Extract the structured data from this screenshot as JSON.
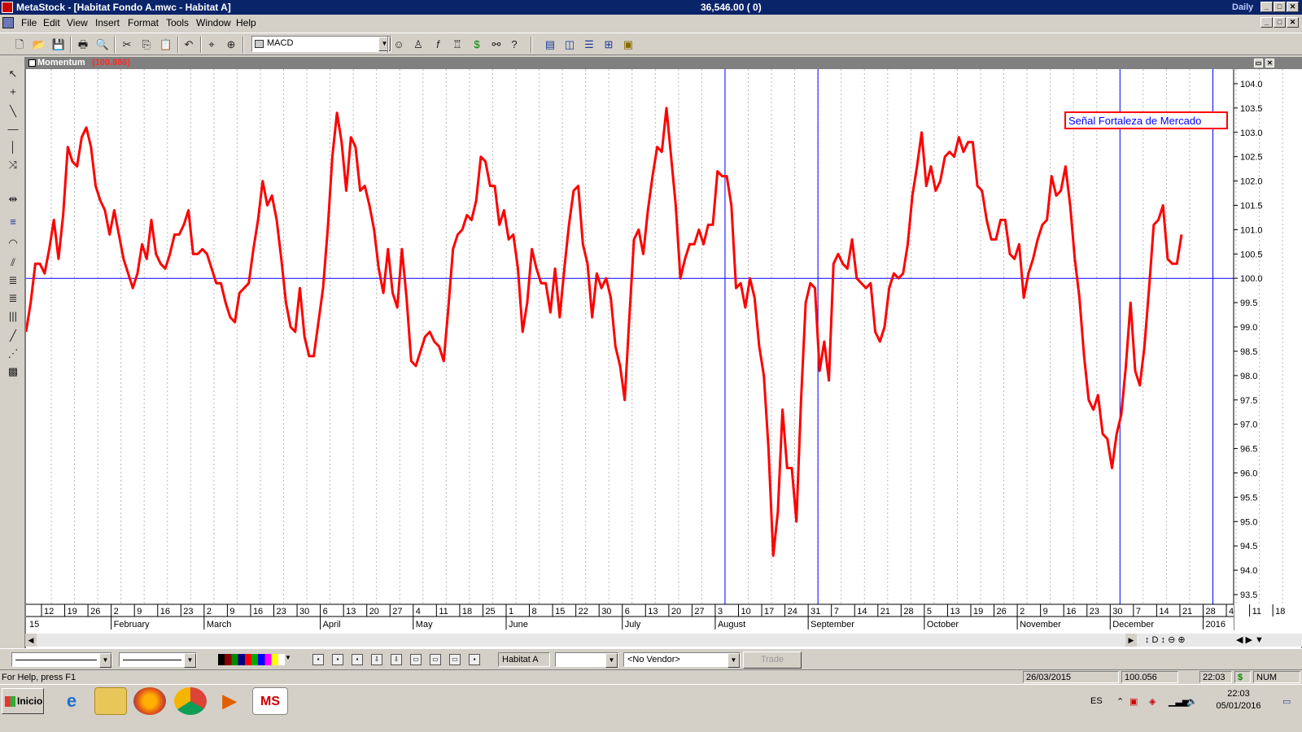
{
  "window": {
    "title": "MetaStock - [Habitat Fondo A.mwc - Habitat A]",
    "center_text": "36,546.00 ( 0)",
    "periodicity": "Daily"
  },
  "menu": {
    "items": [
      "File",
      "Edit",
      "View",
      "Insert",
      "Format",
      "Tools",
      "Window",
      "Help"
    ]
  },
  "toolbar": {
    "indicator_combo": "MACD"
  },
  "chart_window": {
    "indicator_name": "Momentum",
    "indicator_value": "(100.886)"
  },
  "chart_data": {
    "type": "line",
    "title": "",
    "xlabel": "",
    "ylabel": "",
    "ylim": [
      93.3,
      104.3
    ],
    "yticks": [
      "104.0",
      "103.5",
      "103.0",
      "102.5",
      "102.0",
      "101.5",
      "101.0",
      "100.5",
      "100.0",
      "99.5",
      "99.0",
      "98.5",
      "98.0",
      "97.5",
      "97.0",
      "96.5",
      "96.0",
      "95.5",
      "95.0",
      "94.5",
      "94.0",
      "93.5"
    ],
    "reference_line": 100.0,
    "vertical_markers": [
      "Aug 4",
      "Aug 24",
      "Nov 23",
      "Jan 4"
    ],
    "day_ticks": [
      "12",
      "19",
      "26",
      "2",
      "9",
      "16",
      "23",
      "2",
      "9",
      "16",
      "23",
      "30",
      "6",
      "13",
      "20",
      "27",
      "4",
      "11",
      "18",
      "25",
      "1",
      "8",
      "15",
      "22",
      "30",
      "6",
      "13",
      "20",
      "27",
      "3",
      "10",
      "17",
      "24",
      "31",
      "7",
      "14",
      "21",
      "28",
      "5",
      "13",
      "19",
      "26",
      "2",
      "9",
      "16",
      "23",
      "30",
      "7",
      "14",
      "21",
      "28",
      "4",
      "11",
      "18"
    ],
    "month_labels": [
      "15",
      "February",
      "March",
      "April",
      "May",
      "June",
      "July",
      "August",
      "September",
      "October",
      "November",
      "December",
      "2016"
    ],
    "annotation": "Señal Fortaleza de Mercado",
    "line_color": "#ff0000",
    "grid": "vertical dotted",
    "series": [
      {
        "values": [
          98.9,
          99.5,
          100.3,
          100.3,
          100.1,
          100.6,
          101.2,
          100.4,
          101.3,
          102.7,
          102.4,
          102.3,
          102.9,
          103.1,
          102.7,
          101.9,
          101.6,
          101.4,
          100.9,
          101.4,
          100.9,
          100.4,
          100.1,
          99.8,
          100.1,
          100.7,
          100.4,
          101.2,
          100.5,
          100.3,
          100.2,
          100.5,
          100.9,
          100.9,
          101.1,
          101.4,
          100.5,
          100.5,
          100.6,
          100.5,
          100.2,
          99.9,
          99.9,
          99.5,
          99.2,
          99.1,
          99.7,
          99.8,
          99.9,
          100.6,
          101.2,
          102.0,
          101.5,
          101.7,
          101.2,
          100.4,
          99.5,
          99.0,
          98.9,
          99.8,
          98.8,
          98.4,
          98.4,
          99.1,
          99.8,
          101.0,
          102.5,
          103.4,
          102.8,
          101.8,
          102.9,
          102.7,
          101.8,
          101.9,
          101.5,
          101.0,
          100.2,
          99.7,
          100.6,
          99.7,
          99.4,
          100.6,
          99.6,
          98.3,
          98.2,
          98.5,
          98.8,
          98.9,
          98.7,
          98.6,
          98.3,
          99.4,
          100.6,
          100.9,
          101.0,
          101.3,
          101.2,
          101.6,
          102.5,
          102.4,
          101.9,
          101.9,
          101.1,
          101.4,
          100.8,
          100.9,
          100.2,
          98.9,
          99.5,
          100.6,
          100.2,
          99.9,
          99.9,
          99.3,
          100.2,
          99.2,
          100.2,
          101.1,
          101.8,
          101.9,
          100.7,
          100.3,
          99.2,
          100.1,
          99.8,
          100.0,
          99.6,
          98.6,
          98.2,
          97.5,
          99.2,
          100.8,
          101.0,
          100.5,
          101.4,
          102.1,
          102.7,
          102.6,
          103.5,
          102.5,
          101.5,
          100.0,
          100.4,
          100.7,
          100.7,
          101.0,
          100.7,
          101.1,
          101.1,
          102.2,
          102.1,
          102.1,
          101.5,
          99.8,
          99.9,
          99.4,
          100.0,
          99.6,
          98.6,
          98.0,
          96.5,
          94.3,
          95.2,
          97.3,
          96.1,
          96.1,
          95.0,
          97.5,
          99.5,
          99.9,
          99.8,
          98.1,
          98.7,
          97.9,
          100.3,
          100.5,
          100.3,
          100.2,
          100.8,
          100.0,
          99.9,
          99.8,
          99.9,
          98.9,
          98.7,
          99.0,
          99.8,
          100.1,
          100.0,
          100.1,
          100.7,
          101.7,
          102.3,
          103.0,
          101.9,
          102.3,
          101.8,
          102.0,
          102.5,
          102.6,
          102.5,
          102.9,
          102.6,
          102.8,
          102.8,
          101.9,
          101.8,
          101.2,
          100.8,
          100.8,
          101.2,
          101.2,
          100.5,
          100.4,
          100.7,
          99.6,
          100.1,
          100.4,
          100.8,
          101.1,
          101.2,
          102.1,
          101.7,
          101.8,
          102.3,
          101.5,
          100.4,
          99.6,
          98.4,
          97.5,
          97.3,
          97.6,
          96.8,
          96.7,
          96.1,
          96.8,
          97.2,
          98.2,
          99.5,
          98.1,
          97.8,
          98.6,
          99.8,
          101.1,
          101.2,
          101.5,
          100.4,
          100.3,
          100.3,
          100.9
        ]
      }
    ]
  },
  "bottom_toolbar": {
    "security_name": "Habitat A",
    "vendor": "<No Vendor>",
    "trade_label": "Trade"
  },
  "status": {
    "help_text": "For Help, press F1",
    "date": "26/03/2015",
    "value": "100.056",
    "time": "22:03",
    "num": "NUM"
  },
  "taskbar": {
    "start_label": "Inicio",
    "lang": "ES",
    "clock_time": "22:03",
    "clock_date": "05/01/2016"
  }
}
